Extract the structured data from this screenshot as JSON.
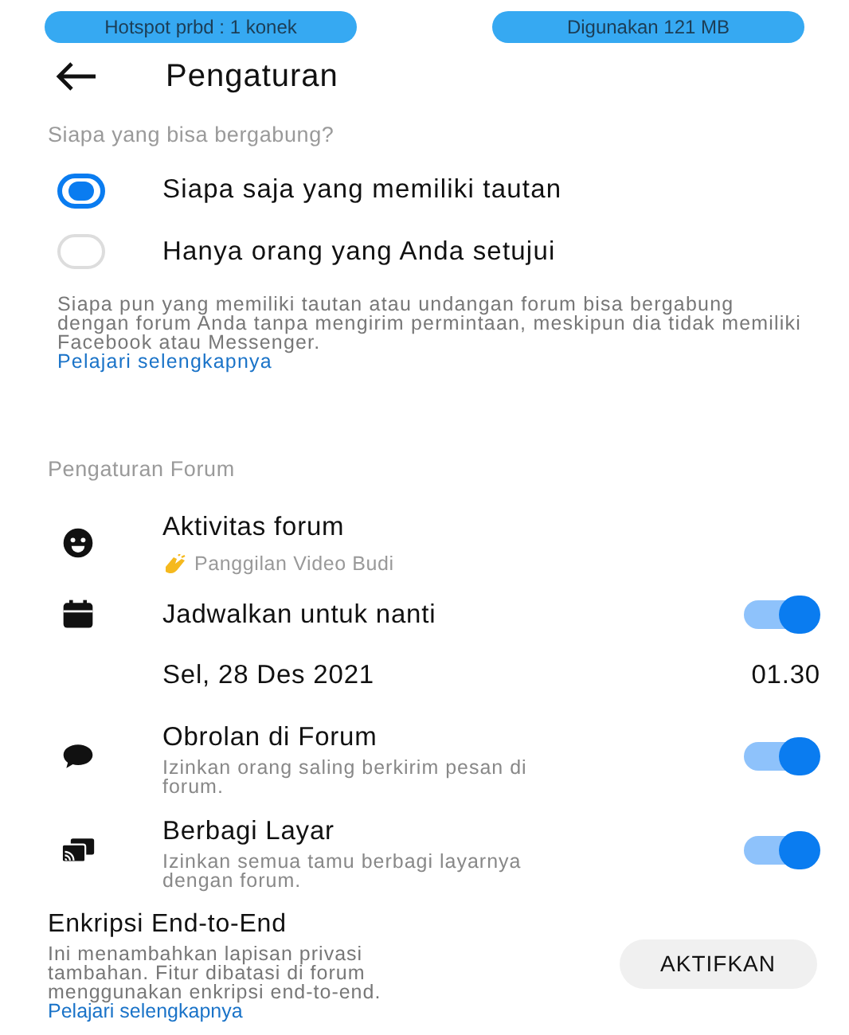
{
  "status_bar": {
    "hotspot": "Hotspot prbd : 1 konek",
    "usage": "Digunakan 121 MB"
  },
  "header": {
    "title": "Pengaturan"
  },
  "join": {
    "label": "Siapa yang bisa bergabung?",
    "options": [
      {
        "label": "Siapa saja yang memiliki tautan",
        "selected": true
      },
      {
        "label": "Hanya orang yang Anda setujui",
        "selected": false
      }
    ],
    "description": "Siapa pun yang memiliki tautan atau undangan forum bisa bergabung dengan forum Anda tanpa mengirim permintaan, meskipun dia tidak memiliki Facebook atau Messenger.",
    "link": "Pelajari selengkapnya"
  },
  "forum": {
    "label": "Pengaturan Forum",
    "rows": [
      {
        "kind": "activity",
        "title": "Aktivitas forum",
        "subtitle": "Panggilan Video Budi"
      },
      {
        "kind": "toggle",
        "title": "Jadwalkan untuk nanti",
        "on": true
      },
      {
        "kind": "datetime",
        "date": "Sel, 28 Des 2021",
        "time": "01.30"
      },
      {
        "kind": "toggle",
        "title": "Obrolan di Forum",
        "subtitle": "Izinkan orang saling berkirim pesan di forum.",
        "on": true
      },
      {
        "kind": "toggle",
        "title": "Berbagi Layar",
        "subtitle": "Izinkan semua tamu berbagi layarnya dengan forum.",
        "on": true
      }
    ]
  },
  "encryption": {
    "title": "Enkripsi End-to-End",
    "description": "Ini menambahkan lapisan privasi tambahan. Fitur dibatasi di forum menggunakan enkripsi end-to-end.",
    "link": "Pelajari selengkapnya",
    "button": "AKTIFKAN"
  }
}
